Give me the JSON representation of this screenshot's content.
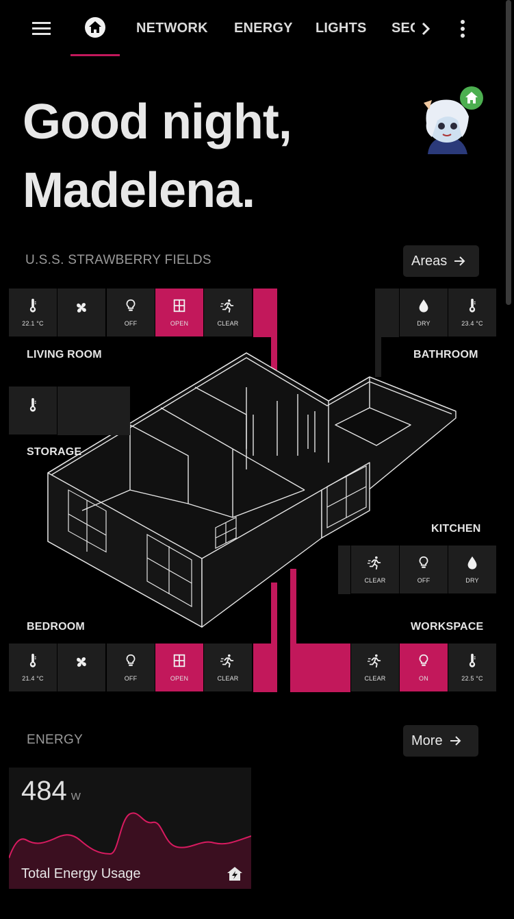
{
  "nav": {
    "menu_icon": "menu-icon",
    "home_icon": "home-icon",
    "tabs": [
      {
        "label": "NETWORK"
      },
      {
        "label": "ENERGY"
      },
      {
        "label": "LIGHTS"
      },
      {
        "label": "SEC"
      }
    ],
    "scroll_icon": "chevron-right-icon",
    "overflow_icon": "more-vert-icon"
  },
  "greeting": {
    "line1": "Good night,",
    "line2": "Madelena."
  },
  "home_section": {
    "title": "U.S.S. STRAWBERRY FIELDS",
    "button_label": "Areas"
  },
  "rooms": {
    "living_room": {
      "name": "LIVING ROOM",
      "tiles": [
        {
          "icon": "thermometer-icon",
          "label": "22.1 °C"
        },
        {
          "icon": "fan-icon",
          "label": ""
        },
        {
          "icon": "bulb-icon",
          "label": "OFF"
        },
        {
          "icon": "window-icon",
          "label": "OPEN"
        },
        {
          "icon": "motion-icon",
          "label": "CLEAR"
        }
      ]
    },
    "bathroom": {
      "name": "BATHROOM",
      "tiles": [
        {
          "icon": "water-drop-icon",
          "label": "DRY"
        },
        {
          "icon": "thermometer-icon",
          "label": "23.4 °C"
        }
      ]
    },
    "storage": {
      "name": "STORAGE",
      "tiles": [
        {
          "icon": "thermometer-icon",
          "label": ""
        }
      ]
    },
    "kitchen": {
      "name": "KITCHEN",
      "tiles": [
        {
          "icon": "motion-icon",
          "label": "CLEAR"
        },
        {
          "icon": "bulb-icon",
          "label": "OFF"
        },
        {
          "icon": "water-drop-icon",
          "label": "DRY"
        }
      ]
    },
    "bedroom": {
      "name": "BEDROOM",
      "tiles": [
        {
          "icon": "thermometer-icon",
          "label": "21.4 °C"
        },
        {
          "icon": "fan-icon",
          "label": ""
        },
        {
          "icon": "bulb-icon",
          "label": "OFF"
        },
        {
          "icon": "window-icon",
          "label": "OPEN"
        },
        {
          "icon": "motion-icon",
          "label": "CLEAR"
        }
      ]
    },
    "workspace": {
      "name": "WORKSPACE",
      "tiles": [
        {
          "icon": "motion-icon",
          "label": "CLEAR"
        },
        {
          "icon": "bulb-icon",
          "label": "ON"
        },
        {
          "icon": "thermometer-icon",
          "label": "22.5 °C"
        }
      ]
    }
  },
  "energy_section": {
    "title": "ENERGY",
    "button_label": "More"
  },
  "energy_card": {
    "value": "484",
    "unit": "W",
    "label": "Total Energy Usage",
    "icon": "home-lightning-icon"
  },
  "colors": {
    "accent": "#c2185b",
    "tile": "#1e1e1e",
    "background": "#000000",
    "badge": "#4caf50"
  }
}
